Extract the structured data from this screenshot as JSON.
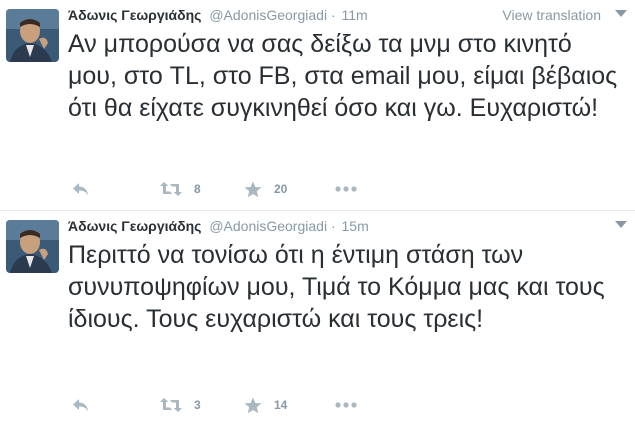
{
  "tweets": [
    {
      "name": "Άδωνις Γεωργιάδης",
      "handle": "@AdonisGeorgiadi",
      "separator": "·",
      "time": "11m",
      "view_translation": "View translation",
      "text": "Αν μπορούσα να σας δείξω τα μνμ στο κινητό μου, στο TL, στο FB, στα email μου, είμαι βέβαιος ότι θα είχατε συγκινηθεί όσο και γω. Ευχαριστώ!",
      "retweets": "8",
      "favorites": "20"
    },
    {
      "name": "Άδωνις Γεωργιάδης",
      "handle": "@AdonisGeorgiadi",
      "separator": "·",
      "time": "15m",
      "view_translation": "",
      "text": "Περιττό να τονίσω ότι η έντιμη στάση των συνυποψηφίων μου, Τιμά το Κόμμα μας και τους ίδιους. Τους ευχαριστώ και τους τρεις!",
      "retweets": "3",
      "favorites": "14"
    }
  ],
  "icons": {
    "reply": "reply-icon",
    "retweet": "retweet-icon",
    "favorite": "star-icon",
    "more": "more-icon",
    "dropdown": "chevron-down-icon",
    "avatar": "avatar"
  },
  "colors": {
    "text": "#292f33",
    "muted": "#8899a6",
    "icon": "#aab8c2",
    "divider": "#e1e8ed"
  }
}
